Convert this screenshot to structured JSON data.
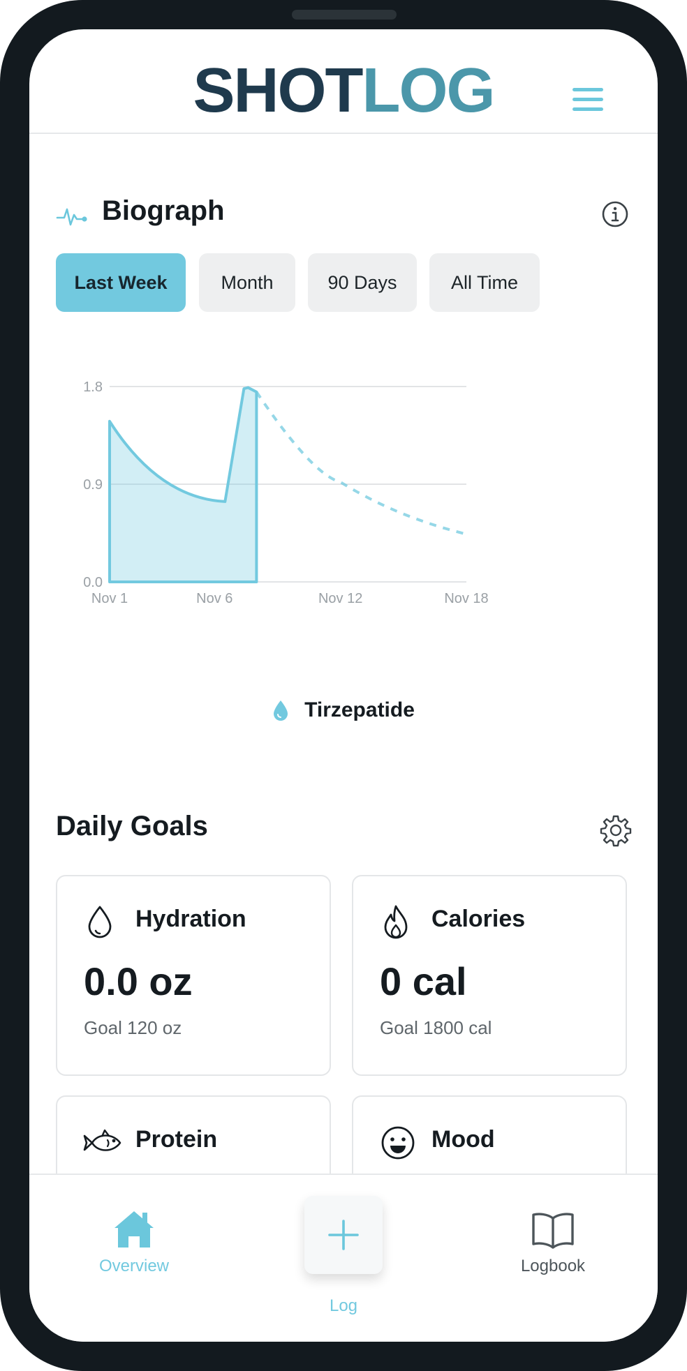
{
  "app": {
    "logo_part1": "SHOT",
    "logo_part2": "LOG"
  },
  "biograph": {
    "title": "Biograph",
    "tabs": [
      "Last Week",
      "Month",
      "90 Days",
      "All Time"
    ],
    "active_tab": "Last Week",
    "legend": "Tirzepatide"
  },
  "chart_data": {
    "type": "area",
    "xlabel": "",
    "ylabel": "",
    "x_ticks": [
      "Nov 1",
      "Nov 6",
      "Nov 12",
      "Nov 18"
    ],
    "y_ticks": [
      "0.0",
      "0.9",
      "1.8"
    ],
    "ylim": [
      0,
      1.8
    ],
    "grid": true,
    "series": [
      {
        "name": "Tirzepatide",
        "style": "solid-filled",
        "x": [
          "Nov 1",
          "Nov 6.5",
          "Nov 7.4",
          "Nov 7.6",
          "Nov 8.0"
        ],
        "values": [
          1.48,
          0.74,
          1.78,
          1.79,
          1.75
        ]
      },
      {
        "name": "Tirzepatide",
        "style": "dashed-projection",
        "x": [
          "Nov 8.0",
          "Nov 12",
          "Nov 18"
        ],
        "values": [
          1.75,
          0.92,
          0.44
        ]
      }
    ],
    "color": "#72c9df"
  },
  "goals": {
    "title": "Daily Goals",
    "cards": [
      {
        "icon": "water-drop-icon",
        "title": "Hydration",
        "value": "0.0 oz",
        "goal": "Goal 120 oz"
      },
      {
        "icon": "flame-icon",
        "title": "Calories",
        "value": "0 cal",
        "goal": "Goal 1800 cal"
      },
      {
        "icon": "fish-icon",
        "title": "Protein"
      },
      {
        "icon": "smiley-icon",
        "title": "Mood"
      }
    ]
  },
  "nav": {
    "overview": "Overview",
    "log": "Log",
    "logbook": "Logbook"
  },
  "colors": {
    "accent": "#72c9df",
    "dark": "#1f3a4d",
    "logo_teal": "#4b97aa"
  }
}
